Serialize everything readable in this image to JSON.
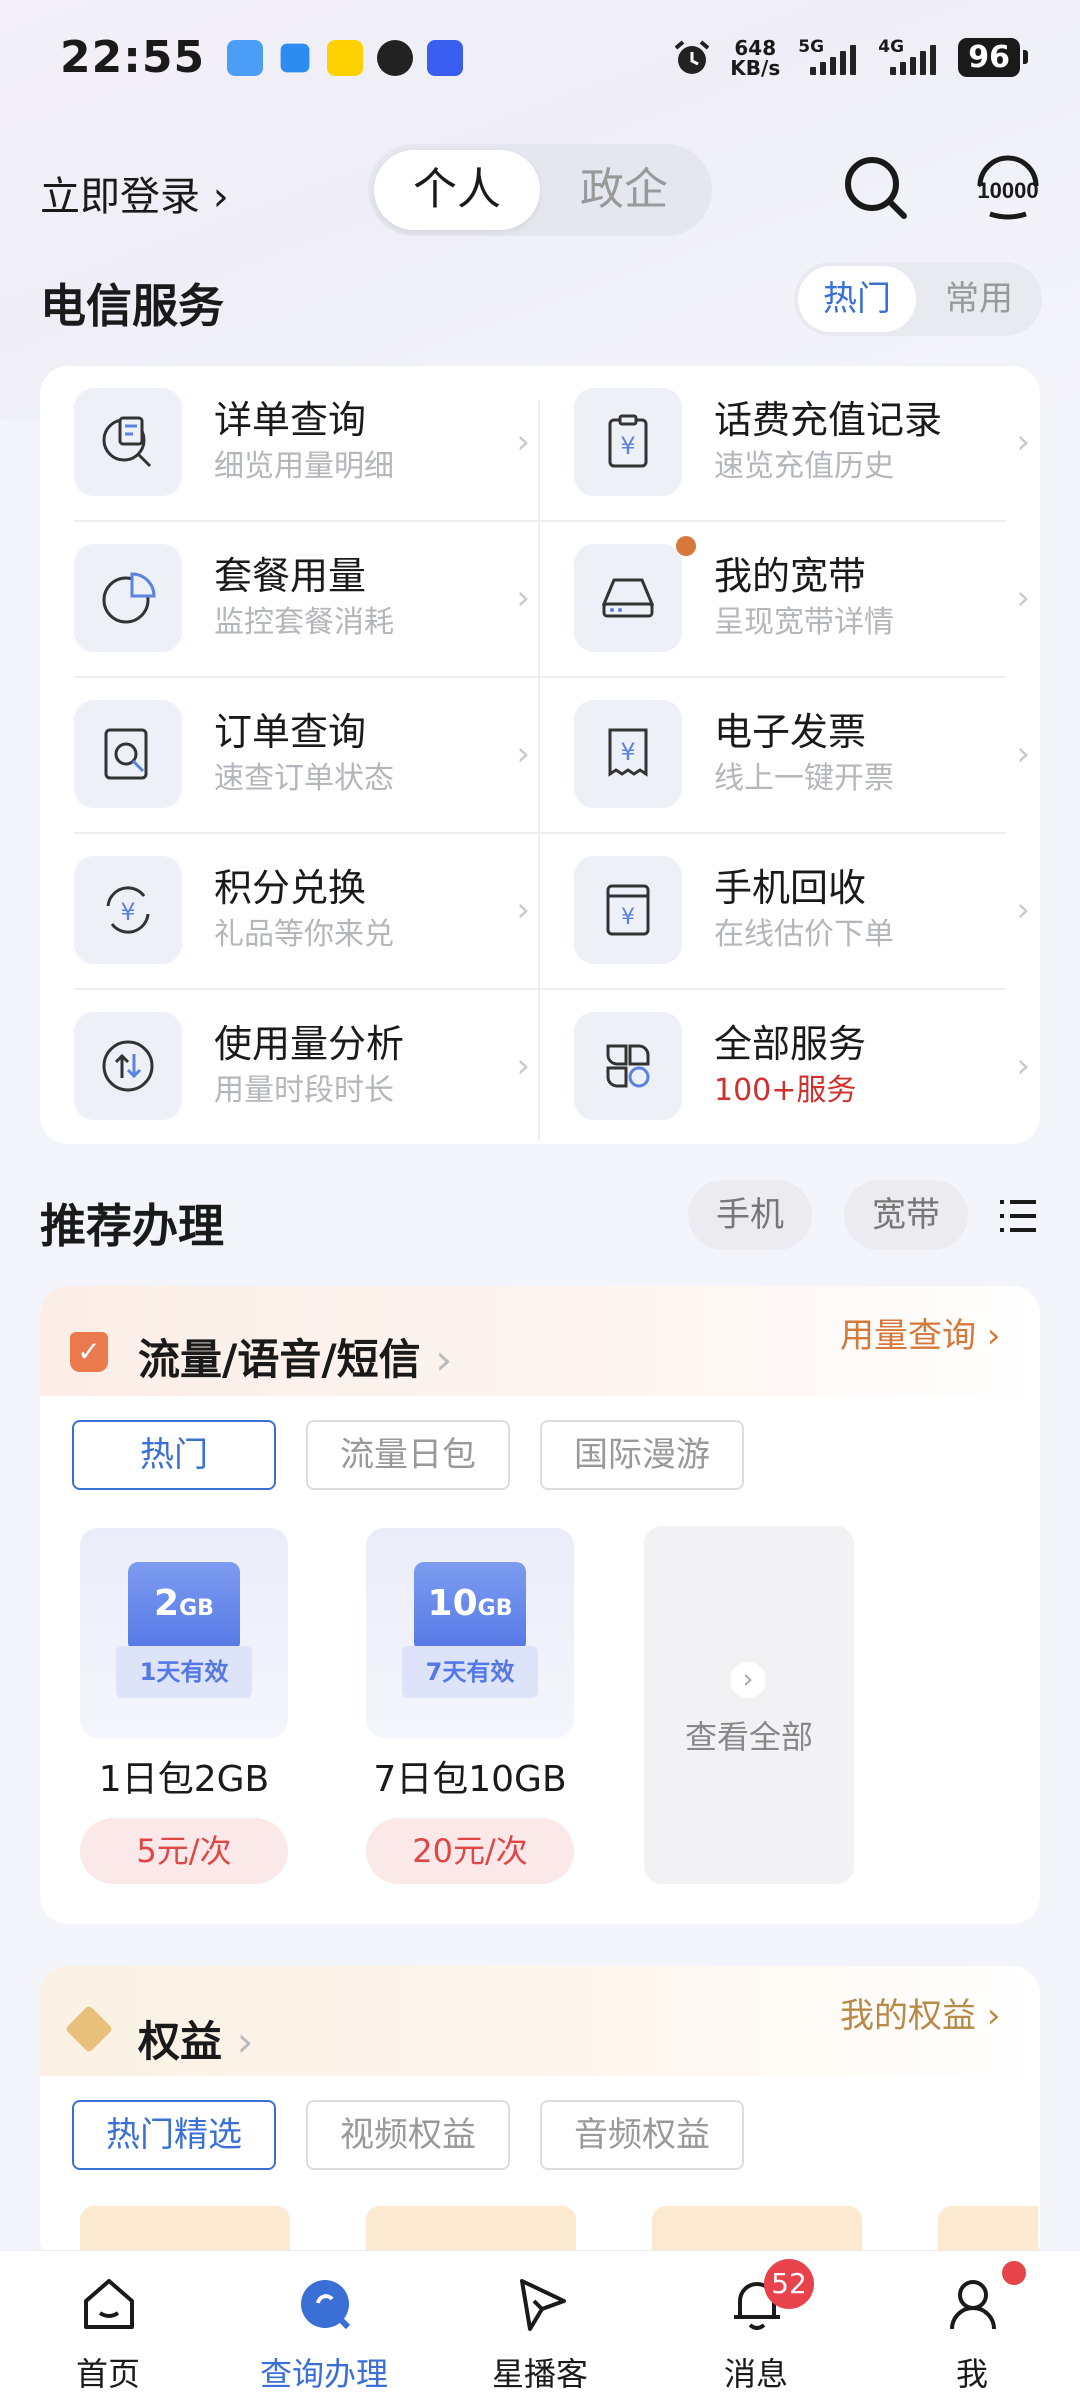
{
  "status_bar": {
    "time": "22:55",
    "net_speed_value": "648",
    "net_speed_unit": "KB/s",
    "sig1_label": "5G",
    "sig2_label": "4G",
    "battery": "96"
  },
  "header": {
    "login": "立即登录",
    "seg_personal": "个人",
    "seg_enterprise": "政企"
  },
  "telecom": {
    "title": "电信服务",
    "tab_hot": "热门",
    "tab_common": "常用",
    "items": [
      {
        "title": "详单查询",
        "sub": "细览用量明细"
      },
      {
        "title": "话费充值记录",
        "sub": "速览充值历史"
      },
      {
        "title": "套餐用量",
        "sub": "监控套餐消耗"
      },
      {
        "title": "我的宽带",
        "sub": "呈现宽带详情"
      },
      {
        "title": "订单查询",
        "sub": "速查订单状态"
      },
      {
        "title": "电子发票",
        "sub": "线上一键开票"
      },
      {
        "title": "积分兑换",
        "sub": "礼品等你来兑"
      },
      {
        "title": "手机回收",
        "sub": "在线估价下单"
      },
      {
        "title": "使用量分析",
        "sub": "用量时段时长"
      },
      {
        "title": "全部服务",
        "sub": "100+服务"
      }
    ]
  },
  "recommend": {
    "title": "推荐办理",
    "pill_phone": "手机",
    "pill_broadband": "宽带"
  },
  "traffic": {
    "title": "流量/语音/短信",
    "link": "用量查询",
    "tabs": [
      "热门",
      "流量日包",
      "国际漫游"
    ],
    "packages": [
      {
        "size": "2",
        "unit": "GB",
        "validity": "1天有效",
        "name": "1日包2GB",
        "price": "5元/次"
      },
      {
        "size": "10",
        "unit": "GB",
        "validity": "7天有效",
        "name": "7日包10GB",
        "price": "20元/次"
      }
    ],
    "view_all": "查看全部"
  },
  "benefits": {
    "title": "权益",
    "link": "我的权益",
    "tabs": [
      "热门精选",
      "视频权益",
      "音频权益"
    ]
  },
  "nav": {
    "items": [
      "首页",
      "查询办理",
      "星播客",
      "消息",
      "我"
    ],
    "badge": "52"
  },
  "colors": {
    "accent": "#3a6fd6",
    "red": "#e04646",
    "orange": "#d5783a"
  }
}
